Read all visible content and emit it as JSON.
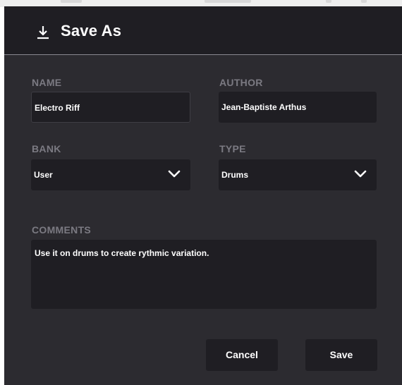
{
  "dialog": {
    "title": "Save As",
    "icon": "download-icon"
  },
  "form": {
    "name": {
      "label": "NAME",
      "value": "Electro Riff"
    },
    "author": {
      "label": "AUTHOR",
      "value": "Jean-Baptiste Arthus"
    },
    "bank": {
      "label": "BANK",
      "value": "User",
      "icon": "chevron-down-icon"
    },
    "type": {
      "label": "TYPE",
      "value": "Drums",
      "icon": "chevron-down-icon"
    },
    "comments": {
      "label": "COMMENTS",
      "value": "Use it on drums to create rythmic variation."
    }
  },
  "buttons": {
    "cancel_label": "Cancel",
    "save_label": "Save"
  },
  "colors": {
    "dialog_bg": "#2c2b30",
    "field_bg": "#1f1e23",
    "label": "#7b7a82",
    "text": "#ffffff"
  }
}
